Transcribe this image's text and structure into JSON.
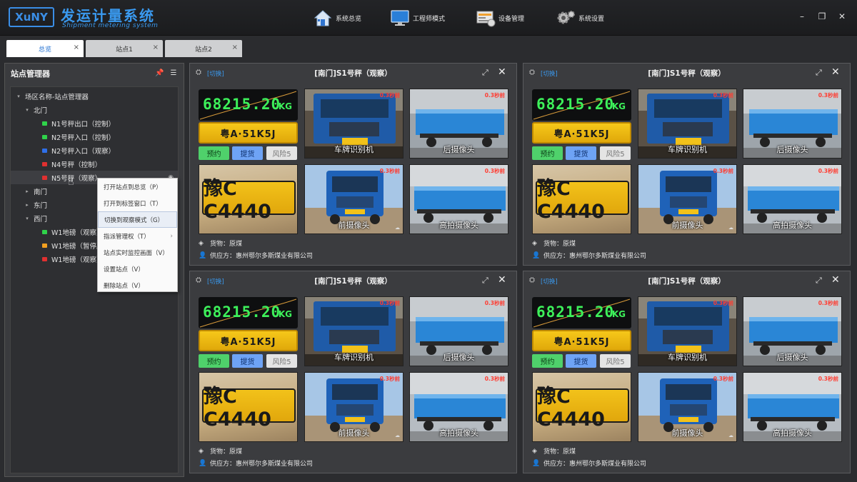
{
  "app": {
    "logo_text": "XuNY",
    "title": "发运计量系统",
    "subtitle": "Shipment metering system"
  },
  "nav": [
    {
      "label": "系统总览",
      "icon": "home-icon"
    },
    {
      "label": "工程师模式",
      "icon": "monitor-icon"
    },
    {
      "label": "设备管理",
      "icon": "device-icon"
    },
    {
      "label": "系统设置",
      "icon": "gear-icon"
    }
  ],
  "window": {
    "minimize": "–",
    "restore": "❐",
    "close": "✕"
  },
  "tabs": [
    {
      "label": "总览",
      "active": true
    },
    {
      "label": "站点1",
      "active": false
    },
    {
      "label": "站点2",
      "active": false
    }
  ],
  "tab_close": "×",
  "left": {
    "title": "站点管理器",
    "tree": [
      {
        "label": "场区名称-站点管理器",
        "level": 0,
        "caret": "▾",
        "dot": ""
      },
      {
        "label": "北门",
        "level": 1,
        "caret": "▾",
        "dot": ""
      },
      {
        "label": "N1号秤出口（控制）",
        "level": 2,
        "caret": "",
        "dot": "#2fd34a"
      },
      {
        "label": "N2号秤入口（控制）",
        "level": 2,
        "caret": "",
        "dot": "#2fd34a"
      },
      {
        "label": "N2号秤入口（观察）",
        "level": 2,
        "caret": "",
        "dot": "#2f6fe8"
      },
      {
        "label": "N4号秤（控制）",
        "level": 2,
        "caret": "",
        "dot": "#e03030"
      },
      {
        "label": "N5号秤（观察）",
        "level": 2,
        "caret": "",
        "dot": "#e03030",
        "selected": true
      },
      {
        "label": "南门",
        "level": 1,
        "caret": "▸",
        "dot": ""
      },
      {
        "label": "东门",
        "level": 1,
        "caret": "▸",
        "dot": ""
      },
      {
        "label": "西门",
        "level": 1,
        "caret": "▾",
        "dot": ""
      },
      {
        "label": "W1地磅（观察）",
        "level": 2,
        "caret": "",
        "dot": "#2fd34a"
      },
      {
        "label": "W1地磅（暂停服",
        "level": 2,
        "caret": "",
        "dot": "#f2a020"
      },
      {
        "label": "W1地磅（观察）",
        "level": 2,
        "caret": "",
        "dot": "#e03030"
      }
    ],
    "context_menu": [
      {
        "label": "打开站点到总览（P）",
        "hover": false,
        "sub": false
      },
      {
        "label": "打开到标签窗口（T）",
        "hover": false,
        "sub": false
      },
      {
        "label": "切换到观察模式（G）",
        "hover": true,
        "sub": false
      },
      {
        "label": "指派管理权（T）",
        "hover": false,
        "sub": true
      },
      {
        "label": "站点实时监控画面（V）",
        "hover": false,
        "sub": false
      },
      {
        "label": "设置站点（V）",
        "hover": false,
        "sub": false
      },
      {
        "label": "删除站点（V）",
        "hover": false,
        "sub": false
      }
    ]
  },
  "monitor": {
    "switch_label": "[切换]",
    "title": "[南门]S1号秤（观察）",
    "weight": "68215.20",
    "unit": "KG",
    "plate": "粤A·51K5J",
    "btn_reserve": "预约",
    "btn_pickup": "提货",
    "btn_risk": "风险5",
    "cam_plate": "车牌识别机",
    "cam_rear": "后摄像头",
    "cam_front": "前摄像头",
    "cam_high": "高拍摄像头",
    "timestamp": "0.3秒前",
    "plate_close_text": "豫C C4440",
    "cargo": "货物：原煤",
    "supplier": "供应方：惠州鄂尔多斯煤业有限公司"
  },
  "colors": {
    "accent": "#3a9af0",
    "weight_digits": "#3df05a",
    "plate_yellow": "#f2c21a",
    "reserve_green": "#4fd16b",
    "pickup_blue": "#6ea3f5",
    "timestamp_red": "#ff3b30"
  }
}
